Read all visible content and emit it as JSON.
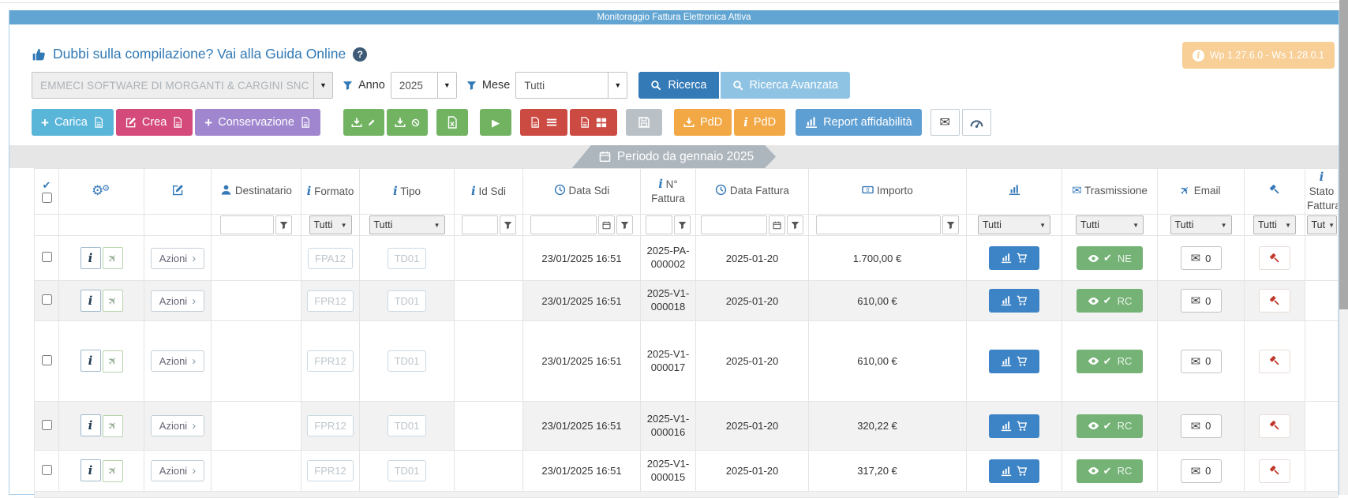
{
  "title_bar": {
    "title": "Monitoraggio Fattura Elettronica Attiva"
  },
  "version_badge": {
    "text": "Wp 1.27.6.0 - Ws 1.28.0.1"
  },
  "help": {
    "link_text": "Dubbi sulla compilazione? Vai alla Guida Online"
  },
  "filters_bar": {
    "company": "EMMECI SOFTWARE DI MORGANTI & CARGINI SNC",
    "anno_label": "Anno",
    "anno_value": "2025",
    "mese_label": "Mese",
    "mese_value": "Tutti",
    "ricerca": "Ricerca",
    "ricerca_avanzata": "Ricerca Avanzata"
  },
  "toolbar": {
    "carica": "Carica",
    "crea": "Crea",
    "conservazione": "Conservazione",
    "pdd_download": "PdD",
    "pdd_info": "PdD",
    "report_affidabilita": "Report affidabilità"
  },
  "period_banner": {
    "text": "Periodo da gennaio 2025"
  },
  "table": {
    "azioni_label": "Azioni",
    "headers": {
      "destinatario": "Destinatario",
      "formato": "Formato",
      "tipo": "Tipo",
      "id_sdi": "Id Sdi",
      "data_sdi": "Data Sdi",
      "n_fattura": "N° Fattura",
      "data_fattura": "Data Fattura",
      "importo": "Importo",
      "trasmissione": "Trasmissione",
      "email": "Email",
      "stato_fattura": "Stato Fattura"
    },
    "filter_all": "Tutti",
    "filter_all_short": "Tut",
    "rows": [
      {
        "formato": "FPA12",
        "tipo": "TD01",
        "data_sdi": "23/01/2025 16:51",
        "n_fattura": "2025-PA-000002",
        "data_fattura": "2025-01-20",
        "importo": "1.700,00 €",
        "stato": "NE",
        "email_count": "0"
      },
      {
        "formato": "FPR12",
        "tipo": "TD01",
        "data_sdi": "23/01/2025 16:51",
        "n_fattura": "2025-V1-000018",
        "data_fattura": "2025-01-20",
        "importo": "610,00 €",
        "stato": "RC",
        "email_count": "0"
      },
      {
        "formato": "FPR12",
        "tipo": "TD01",
        "data_sdi": "23/01/2025 16:51",
        "n_fattura": "2025-V1-000017",
        "data_fattura": "2025-01-20",
        "importo": "610,00 €",
        "stato": "RC",
        "email_count": "0"
      },
      {
        "formato": "FPR12",
        "tipo": "TD01",
        "data_sdi": "23/01/2025 16:51",
        "n_fattura": "2025-V1-000016",
        "data_fattura": "2025-01-20",
        "importo": "320,22 €",
        "stato": "RC",
        "email_count": "0"
      },
      {
        "formato": "FPR12",
        "tipo": "TD01",
        "data_sdi": "23/01/2025 16:51",
        "n_fattura": "2025-V1-000015",
        "data_fattura": "2025-01-20",
        "importo": "317,20 €",
        "stato": "RC",
        "email_count": "0"
      }
    ]
  },
  "icons": {
    "check_glyph": "✔",
    "envelope_glyph": "✉",
    "plane_glyph": "✈",
    "play_glyph": "▶",
    "caret_glyph": "▼",
    "chevron_glyph": "›",
    "gear_glyph": "⚙",
    "info_glyph": "i",
    "plus_glyph": "+",
    "question_glyph": "?"
  },
  "colors": {
    "title_bar": "#62a5d2",
    "primary": "#337ab7",
    "link": "#3179b5",
    "success_green": "#74b275",
    "row_chart_blue": "#3d84c6",
    "badge_orange": "#f8cf96",
    "danger_red": "#cb4a42",
    "toolbar_orange": "#f2a844",
    "crea_pink": "#d44a7a",
    "conservazione_purple": "#9f86ce",
    "carica_blue": "#5ab6d9",
    "hammer_red": "#c0392b"
  }
}
